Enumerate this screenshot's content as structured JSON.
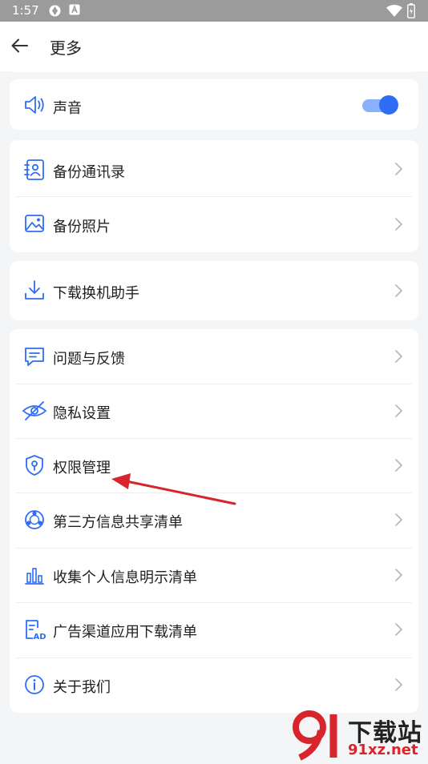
{
  "status_bar": {
    "time": "1:57"
  },
  "header": {
    "title": "更多"
  },
  "sound_card": {
    "label": "声音",
    "toggle_on": true,
    "accent": "#2f6df6"
  },
  "backup_card": {
    "items": [
      {
        "label": "备份通讯录",
        "icon": "contacts-backup-icon"
      },
      {
        "label": "备份照片",
        "icon": "photo-backup-icon"
      }
    ]
  },
  "download_card": {
    "items": [
      {
        "label": "下载换机助手",
        "icon": "download-icon"
      }
    ]
  },
  "info_card": {
    "items": [
      {
        "label": "问题与反馈",
        "icon": "feedback-icon"
      },
      {
        "label": "隐私设置",
        "icon": "privacy-eye-icon"
      },
      {
        "label": "权限管理",
        "icon": "shield-icon"
      },
      {
        "label": "第三方信息共享清单",
        "icon": "share-icon"
      },
      {
        "label": "收集个人信息明示清单",
        "icon": "bar-chart-icon"
      },
      {
        "label": "广告渠道应用下载清单",
        "icon": "ad-list-icon"
      },
      {
        "label": "关于我们",
        "icon": "info-icon"
      }
    ]
  },
  "annotation": {
    "color": "#d8242c"
  },
  "watermark": {
    "brand": "下载站",
    "url": "91xz.net",
    "logo_mark": "91"
  }
}
